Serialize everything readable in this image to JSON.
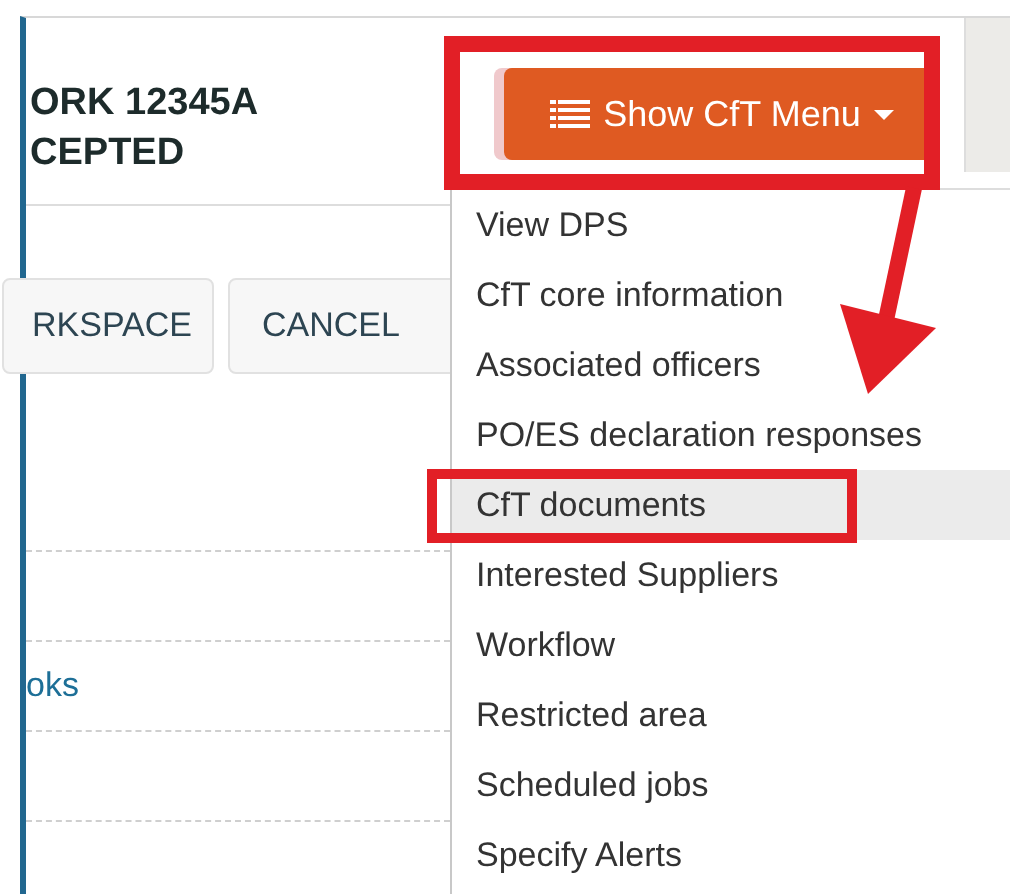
{
  "header": {
    "title_lines": [
      "ORK 12345A",
      "CEPTED"
    ]
  },
  "menu_button": {
    "label": "Show CfT Menu",
    "expanded": true
  },
  "actions": [
    "RKSPACE",
    "CANCEL"
  ],
  "link": "oks",
  "menu_items": [
    {
      "label": "View DPS",
      "selected": false
    },
    {
      "label": "CfT core information",
      "selected": false
    },
    {
      "label": "Associated officers",
      "selected": false
    },
    {
      "label": "PO/ES declaration responses",
      "selected": false
    },
    {
      "label": "CfT documents",
      "selected": true
    },
    {
      "label": "Interested Suppliers",
      "selected": false
    },
    {
      "label": "Workflow",
      "selected": false
    },
    {
      "label": "Restricted area",
      "selected": false
    },
    {
      "label": "Scheduled jobs",
      "selected": false
    },
    {
      "label": "Specify Alerts",
      "selected": false
    }
  ]
}
